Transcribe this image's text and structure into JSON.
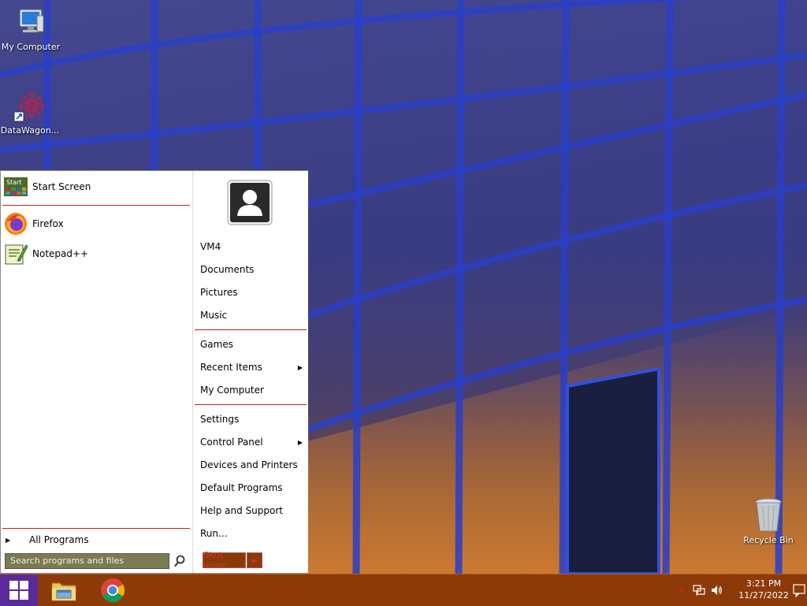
{
  "desktop": {
    "icons": [
      {
        "label": "My Computer",
        "icon": "computer-icon"
      },
      {
        "label": "DataWagon...",
        "icon": "datawagon-icon"
      },
      {
        "label": "Recycle Bin",
        "icon": "recycle-bin-icon"
      }
    ]
  },
  "start_menu": {
    "left": {
      "pinned": [
        {
          "label": "Start Screen",
          "icon": "start-screen-icon",
          "icon_text": "Start"
        },
        {
          "label": "Firefox",
          "icon": "firefox-icon"
        },
        {
          "label": "Notepad++",
          "icon": "notepadpp-icon"
        }
      ],
      "all_programs": "All Programs",
      "search_placeholder": "Search programs and files"
    },
    "right": {
      "user_avatar": "user-avatar-icon",
      "items_group1": [
        "VM4",
        "Documents",
        "Pictures",
        "Music"
      ],
      "items_group2": [
        {
          "label": "Games",
          "submenu": false
        },
        {
          "label": "Recent Items",
          "submenu": true
        },
        {
          "label": "My Computer",
          "submenu": false
        }
      ],
      "items_group3": [
        {
          "label": "Settings",
          "submenu": false
        },
        {
          "label": "Control Panel",
          "submenu": true
        },
        {
          "label": "Devices and Printers",
          "submenu": false
        },
        {
          "label": "Default Programs",
          "submenu": false
        },
        {
          "label": "Help and Support",
          "submenu": false
        },
        {
          "label": "Run...",
          "submenu": false
        }
      ],
      "shutdown_label": "Shut down"
    }
  },
  "taskbar": {
    "apps": [
      {
        "name": "File Explorer",
        "icon": "folder-icon"
      },
      {
        "name": "Google Chrome",
        "icon": "chrome-icon"
      }
    ],
    "clock_time": "3:21 PM",
    "clock_date": "11/27/2022"
  },
  "colors": {
    "taskbar": "#8c3a08",
    "start_button": "#5a2a9a",
    "separator": "#c02020",
    "search_bg": "#7b7a50"
  }
}
